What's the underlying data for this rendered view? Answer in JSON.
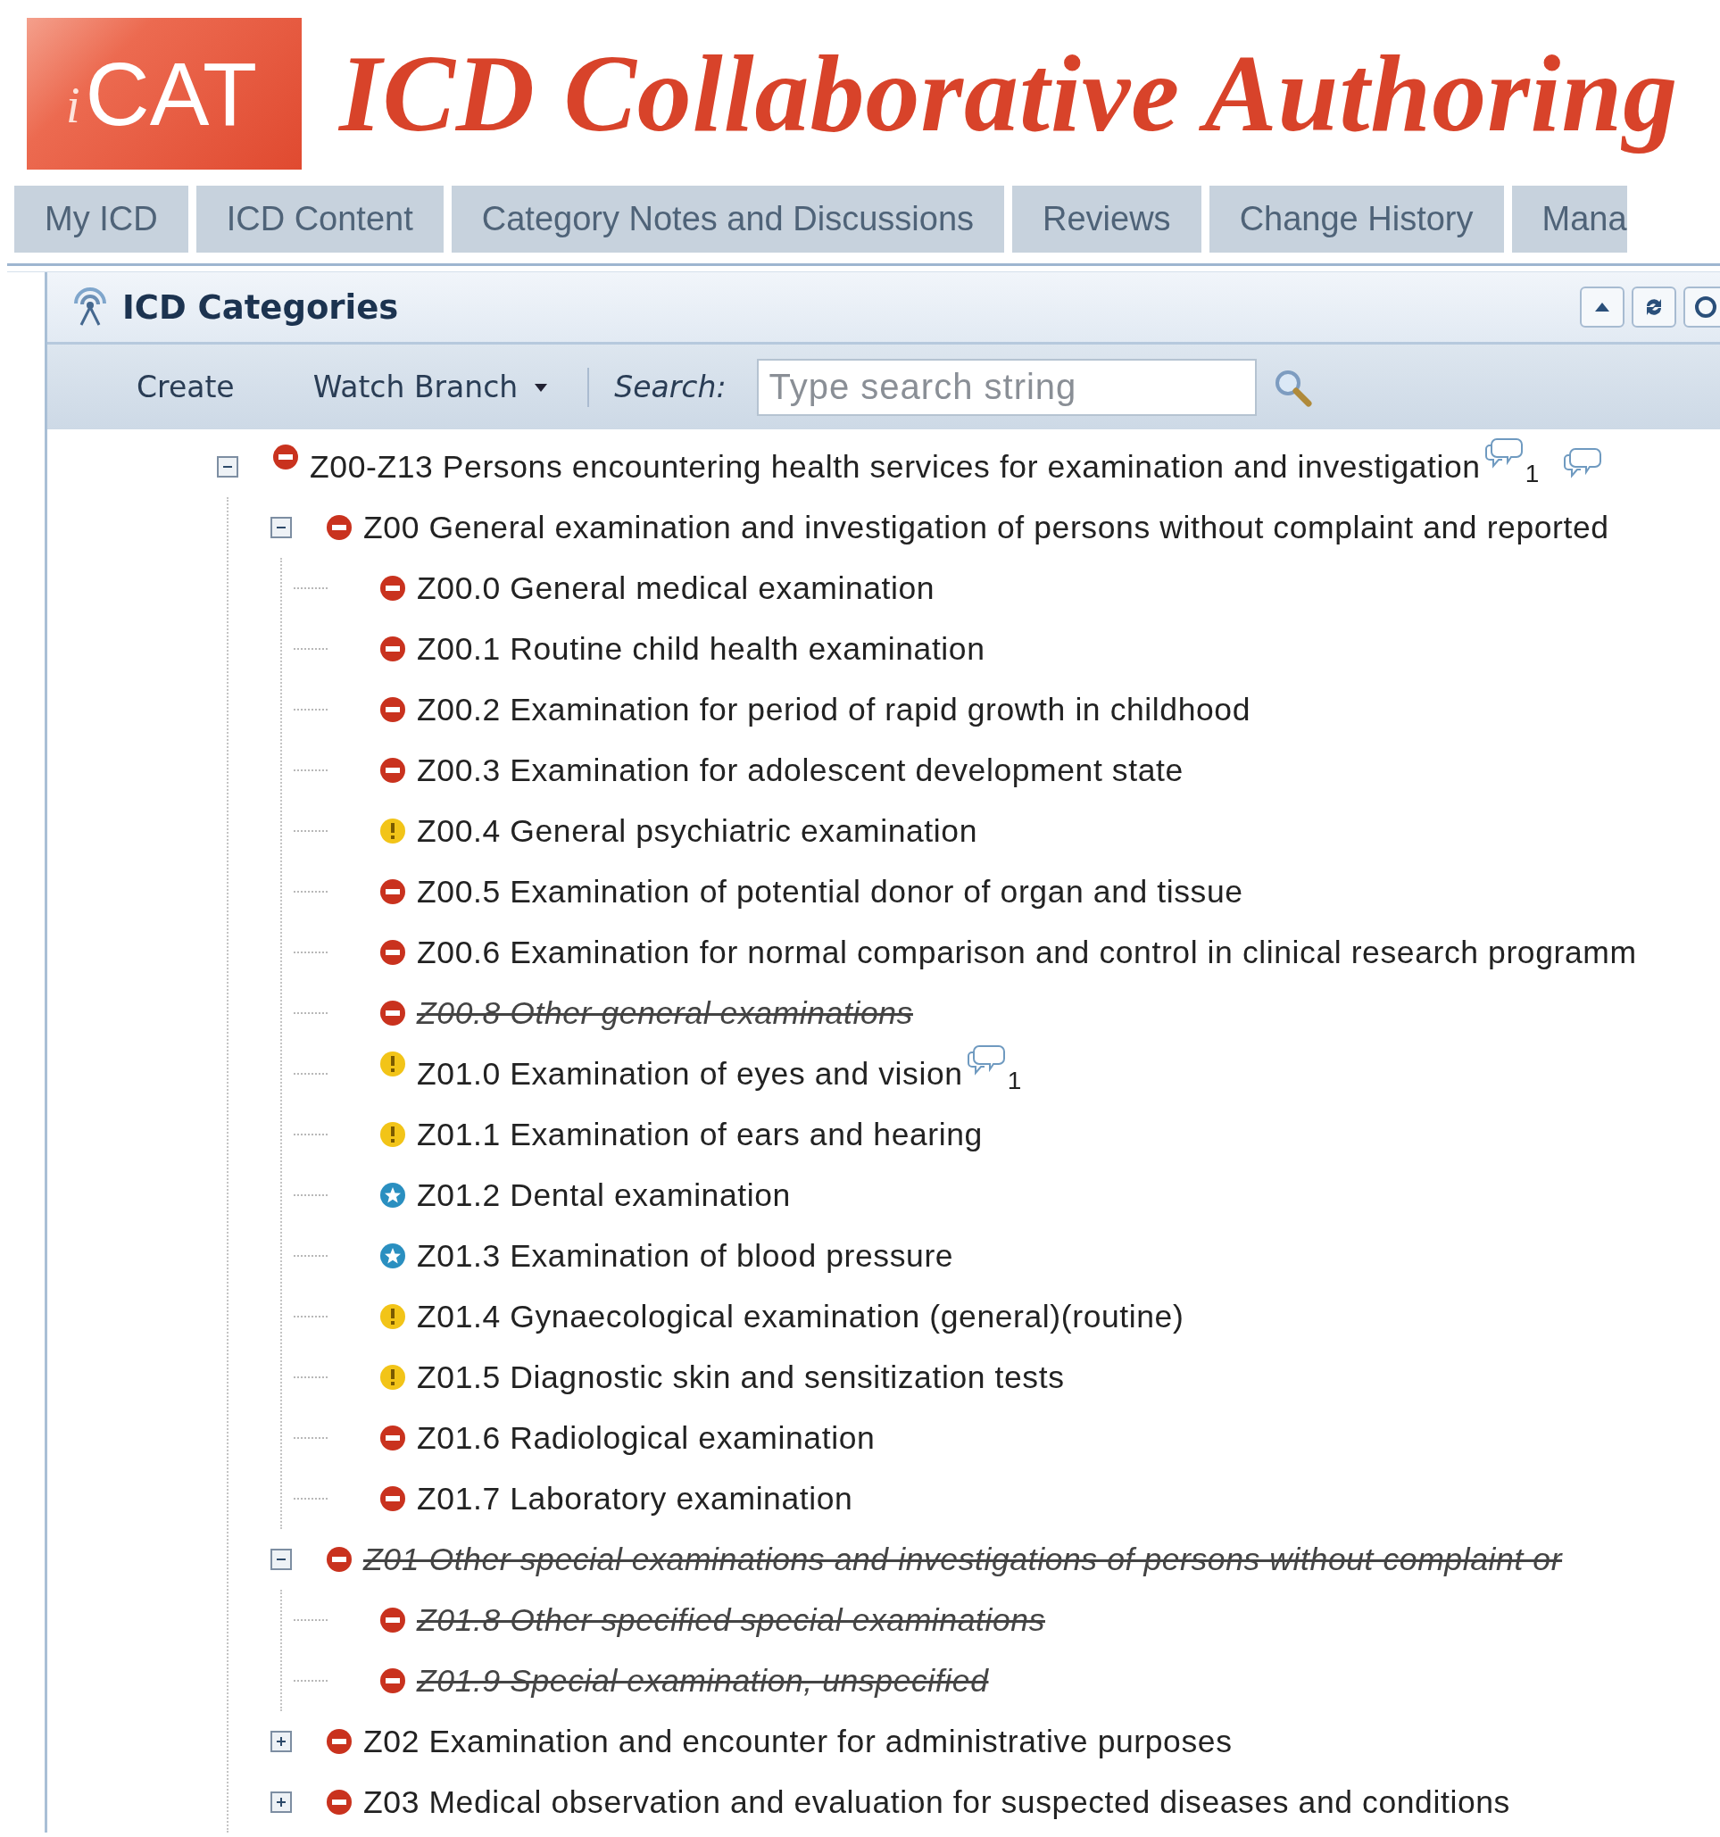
{
  "logo": {
    "prefix": "i",
    "text": "CAT"
  },
  "title": "ICD Collaborative Authoring",
  "tabs": [
    {
      "label": "My ICD",
      "selected": false
    },
    {
      "label": "ICD Content",
      "selected": false
    },
    {
      "label": "Category Notes and Discussions",
      "selected": false
    },
    {
      "label": "Reviews",
      "selected": false
    },
    {
      "label": "Change History",
      "selected": false
    },
    {
      "label": "Mana",
      "selected": false
    }
  ],
  "panel": {
    "title": "ICD Categories",
    "toolbar": {
      "create": "Create",
      "watch_branch": "Watch Branch",
      "search_label": "Search:",
      "search": {
        "placeholder": "Type search string"
      }
    }
  },
  "tree": [
    {
      "label": "Z00-Z13 Persons encountering health services for examination and investigation",
      "kind": "minus",
      "obsolete": false,
      "expanded": true,
      "notes": "1",
      "more_notes": true,
      "children": [
        {
          "label": "Z00 General examination and investigation of persons without complaint and reported",
          "kind": "minus",
          "obsolete": false,
          "expanded": true,
          "children": [
            {
              "label": "Z00.0 General medical examination",
              "kind": "minus",
              "obsolete": false
            },
            {
              "label": "Z00.1 Routine child health examination",
              "kind": "minus",
              "obsolete": false
            },
            {
              "label": "Z00.2 Examination for period of rapid growth in childhood",
              "kind": "minus",
              "obsolete": false
            },
            {
              "label": "Z00.3 Examination for adolescent development state",
              "kind": "minus",
              "obsolete": false
            },
            {
              "label": "Z00.4 General psychiatric examination",
              "kind": "alert",
              "obsolete": false
            },
            {
              "label": "Z00.5 Examination of potential donor of organ and tissue",
              "kind": "minus",
              "obsolete": false
            },
            {
              "label": "Z00.6 Examination for normal comparison and control in clinical research programm",
              "kind": "minus",
              "obsolete": false
            },
            {
              "label": "Z00.8 Other general examinations",
              "kind": "minus",
              "obsolete": true
            },
            {
              "label": "Z01.0 Examination of eyes and vision",
              "kind": "alert",
              "obsolete": false,
              "notes": "1"
            },
            {
              "label": "Z01.1 Examination of ears and hearing",
              "kind": "alert",
              "obsolete": false
            },
            {
              "label": "Z01.2 Dental examination",
              "kind": "star",
              "obsolete": false
            },
            {
              "label": "Z01.3 Examination of blood pressure",
              "kind": "star",
              "obsolete": false
            },
            {
              "label": "Z01.4 Gynaecological examination (general)(routine)",
              "kind": "alert",
              "obsolete": false
            },
            {
              "label": "Z01.5 Diagnostic skin and sensitization tests",
              "kind": "alert",
              "obsolete": false
            },
            {
              "label": "Z01.6 Radiological examination",
              "kind": "minus",
              "obsolete": false
            },
            {
              "label": "Z01.7 Laboratory examination",
              "kind": "minus",
              "obsolete": false
            }
          ]
        },
        {
          "label": "Z01 Other special examinations and investigations of persons without complaint or",
          "kind": "minus",
          "obsolete": true,
          "expanded": true,
          "children": [
            {
              "label": "Z01.8 Other specified special examinations",
              "kind": "minus",
              "obsolete": true
            },
            {
              "label": "Z01.9 Special examination, unspecified",
              "kind": "minus",
              "obsolete": true
            }
          ]
        },
        {
          "label": "Z02 Examination and encounter for administrative purposes",
          "kind": "minus",
          "obsolete": false,
          "expanded": false
        },
        {
          "label": "Z03 Medical observation and evaluation for suspected diseases and conditions",
          "kind": "minus",
          "obsolete": false,
          "expanded": false
        }
      ]
    }
  ]
}
